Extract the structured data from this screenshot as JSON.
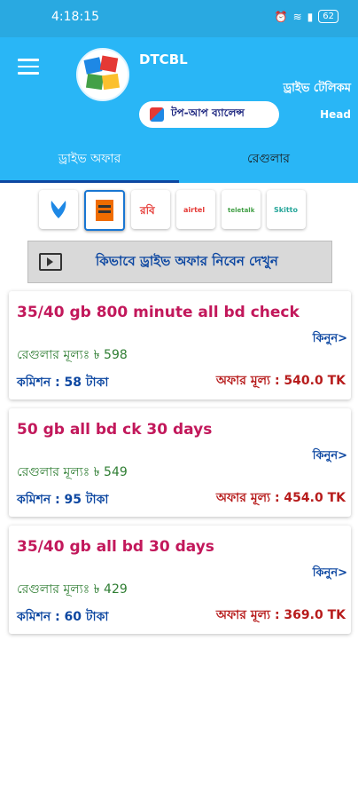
{
  "status": {
    "time": "4:18:15",
    "battery": "62"
  },
  "app": {
    "name": "DTCBL",
    "subtitle": "ড্রাইভ টেলিকম",
    "role": "Head",
    "topup_label": "টপ-আপ ব্যালেন্স"
  },
  "tabs": [
    {
      "label": "ড্রাইভ অফার"
    },
    {
      "label": "রেগুলার"
    }
  ],
  "operators": [
    {
      "name": "Grameenphone",
      "color": "#1e88e5"
    },
    {
      "name": "Banglalink",
      "color": "#ef6c00"
    },
    {
      "name": "Robi",
      "color": "#e53935"
    },
    {
      "name": "Airtel",
      "color": "#e53935"
    },
    {
      "name": "Teletalk",
      "color": "#43a047"
    },
    {
      "name": "Skitto",
      "color": "#26a69a"
    }
  ],
  "video_banner": {
    "text": "কিভাবে ড্রাইভ অফার নিবেন দেখুন"
  },
  "offers": [
    {
      "title": "35/40 gb 800 minute all bd check",
      "buy": "কিনুন>",
      "regular": "রেগুলার মূল্যঃ ৳ 598",
      "commission": "কমিশন : 58 টাকা",
      "offer_price": "অফার মূল্য : 540.0 TK"
    },
    {
      "title": "50 gb all bd ck 30 days",
      "buy": "কিনুন>",
      "regular": "রেগুলার মূল্যঃ ৳ 549",
      "commission": "কমিশন : 95 টাকা",
      "offer_price": "অফার মূল্য : 454.0 TK"
    },
    {
      "title": "35/40 gb all bd 30 days",
      "buy": "কিনুন>",
      "regular": "রেগুলার মূল্যঃ ৳ 429",
      "commission": "কমিশন : 60 টাকা",
      "offer_price": "অফার মূল্য : 369.0 TK"
    }
  ]
}
